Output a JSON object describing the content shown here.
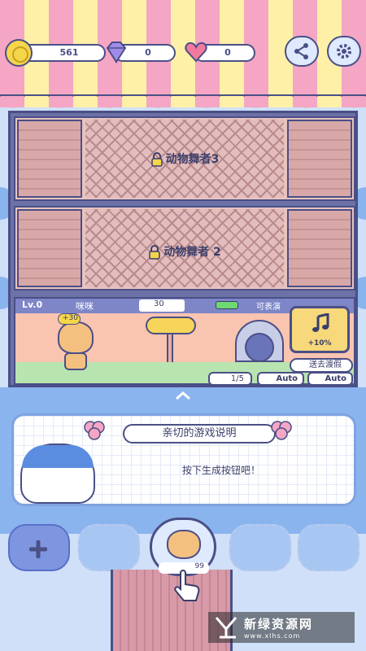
{
  "top_bar": {
    "coins": "561",
    "gems": "0",
    "hearts": "0"
  },
  "icons": {
    "coin": "coin-icon",
    "gem": "diamond-icon",
    "heart": "heart-icon",
    "share": "share-icon",
    "settings": "gear-icon",
    "music": "music-note-icon",
    "lock": "lock-icon"
  },
  "floors": [
    {
      "label": "动物舞者3"
    },
    {
      "label": "动物舞者 2"
    }
  ],
  "stage": {
    "level": "Lv.0",
    "name": "咪咪",
    "music_count": "30",
    "status": "可表演",
    "bonus": "+30",
    "dancers": "1/5",
    "auto1": "Auto",
    "auto2": "Auto",
    "boost": "+10%",
    "vacation": "送去渡假"
  },
  "info": {
    "title": "亲切的游戏说明",
    "body": "按下生成按钮吧！"
  },
  "generator": {
    "count": "99"
  },
  "watermark": {
    "title": "新绿资源网",
    "url": "www.xlhs.com"
  },
  "colors": {
    "awning_pink": "#f4a6c4",
    "awning_yellow": "#fff0a8",
    "outline": "#4a4f86",
    "sky_blue": "#8ab4ee"
  }
}
